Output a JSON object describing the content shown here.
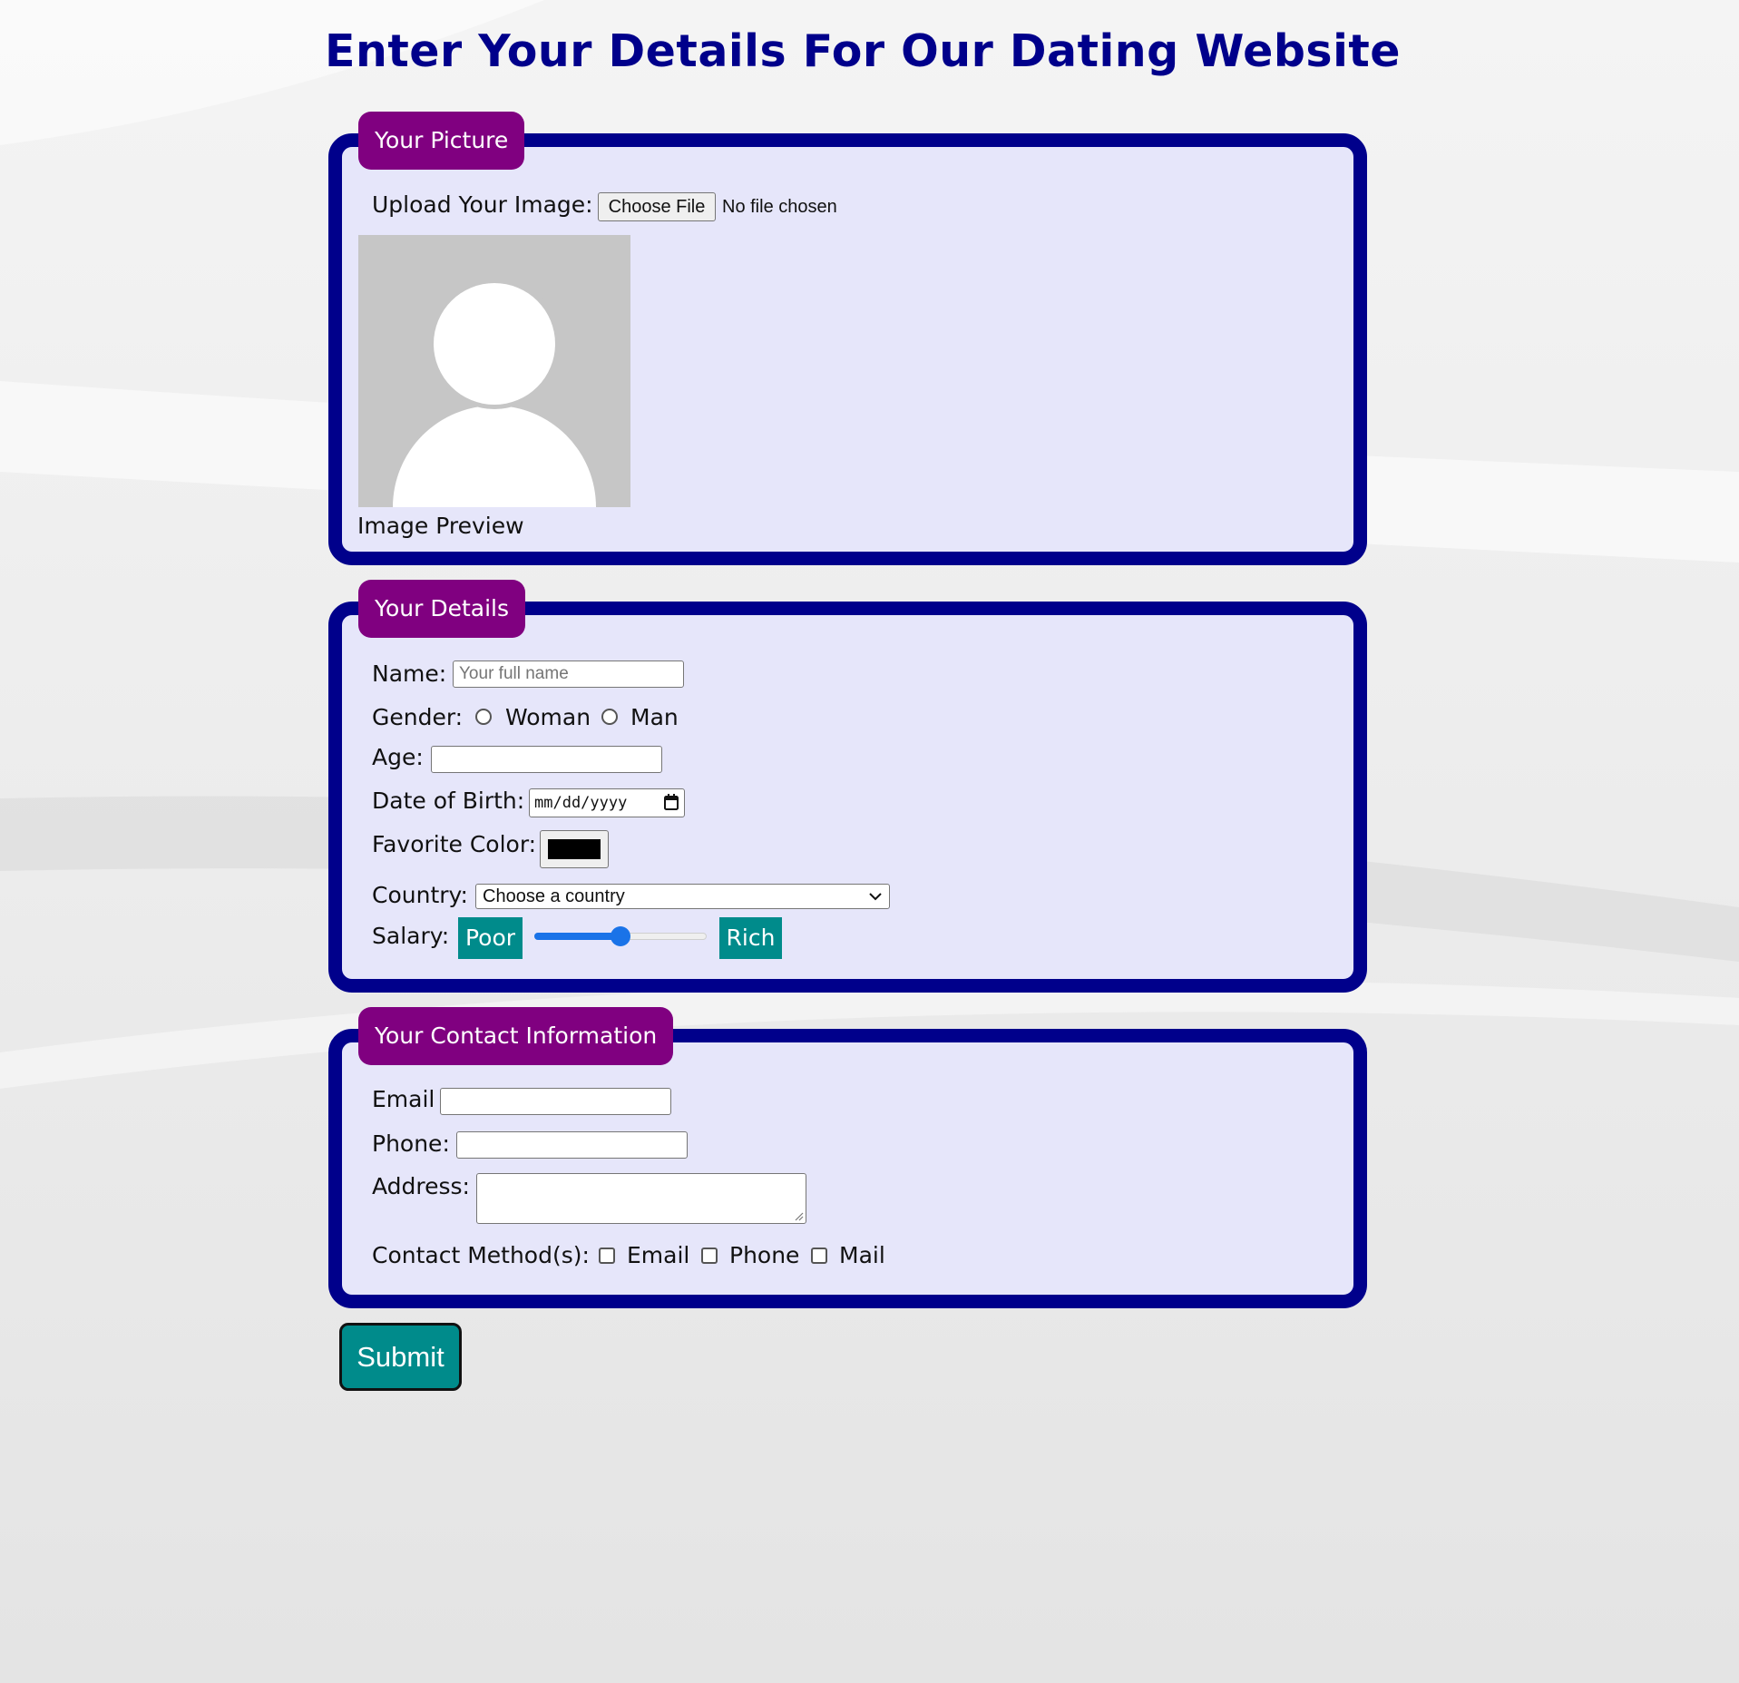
{
  "page": {
    "title": "Enter Your Details For Our Dating Website"
  },
  "colors": {
    "title": "#00008b",
    "border": "#00008b",
    "legend_bg": "#800080",
    "panel_bg": "#e6e6fa",
    "accent_teal": "#008b8b",
    "slider_blue": "#1a73e8"
  },
  "picture": {
    "legend": "Your Picture",
    "upload_label": "Upload Your Image:",
    "file_button": "Choose File",
    "file_status": "No file chosen",
    "preview_caption": "Image Preview",
    "preview_icon": "avatar-placeholder-icon"
  },
  "details": {
    "legend": "Your Details",
    "name_label": "Name:",
    "name_placeholder": "Your full name",
    "gender_label": "Gender:",
    "gender_options": [
      "Woman",
      "Man"
    ],
    "age_label": "Age:",
    "dob_label": "Date of Birth:",
    "dob_placeholder": "mm/dd/yyyy",
    "color_label": "Favorite Color:",
    "color_value": "#000000",
    "country_label": "Country:",
    "country_selected": "Choose a country",
    "salary_label": "Salary:",
    "salary_min_label": "Poor",
    "salary_max_label": "Rich",
    "salary_level": 0.5
  },
  "contact": {
    "legend": "Your Contact Information",
    "email_label": "Email",
    "phone_label": "Phone:",
    "address_label": "Address:",
    "methods_label": "Contact Method(s):",
    "methods": [
      "Email",
      "Phone",
      "Mail"
    ]
  },
  "submit_label": "Submit"
}
